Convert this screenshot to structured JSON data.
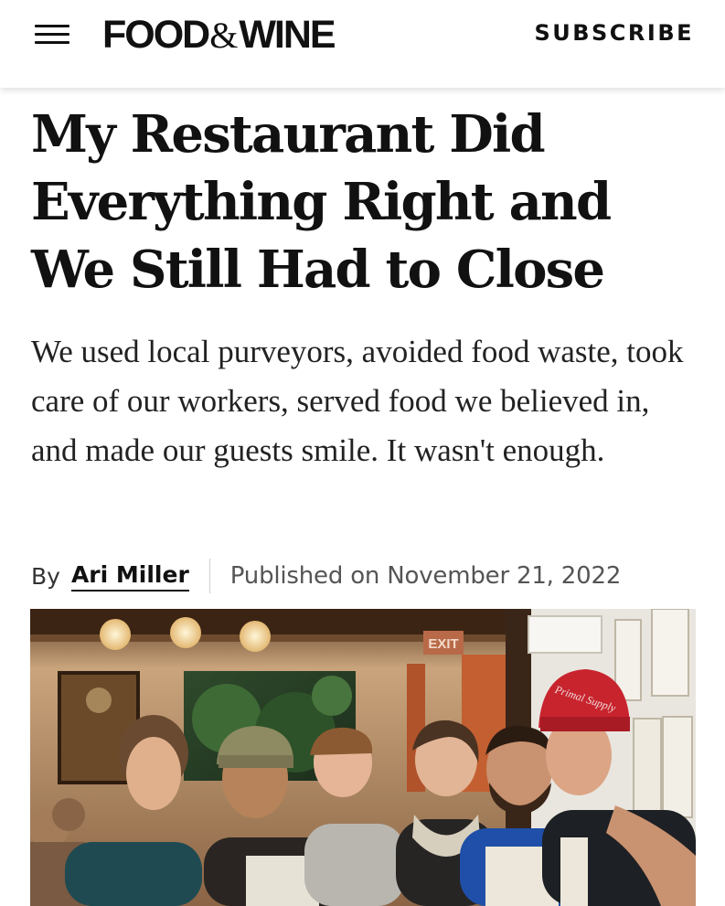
{
  "header": {
    "logo": {
      "left": "FOOD",
      "amp": "&",
      "right": "WINE"
    },
    "subscribe_label": "SUBSCRIBE"
  },
  "article": {
    "headline": "My Restaurant Did Everything Right and We Still Had to Close",
    "dek": "We used local purveyors, avoided food waste, took care of our workers, served food we believed in, and made our guests smile. It wasn't enough.",
    "byline": {
      "by": "By",
      "author": "Ari Miller",
      "published": "Published on November 21, 2022"
    },
    "photo": {
      "exit_sign": "EXIT",
      "hat_text": "Primal Supply"
    }
  }
}
